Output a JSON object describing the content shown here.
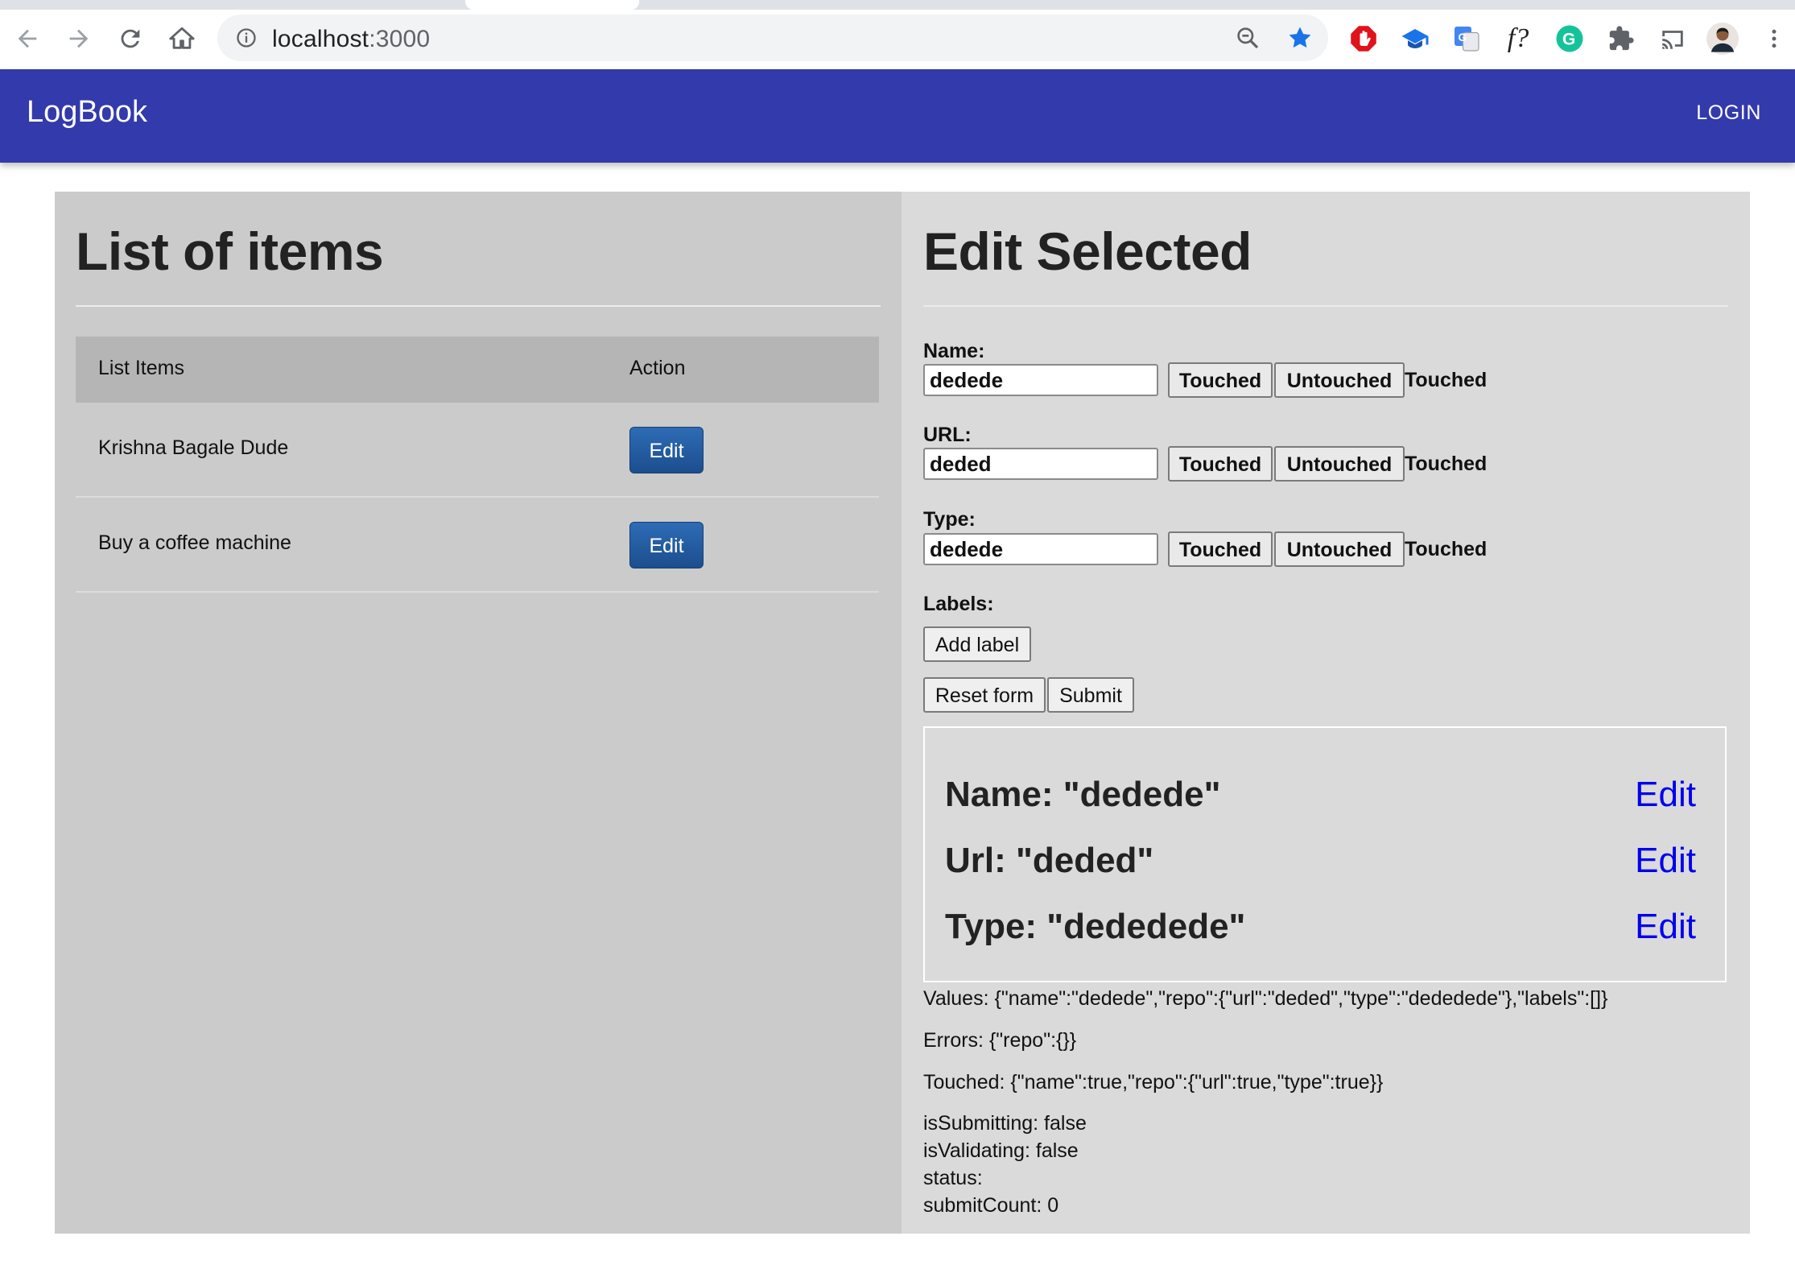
{
  "browser": {
    "url_host": "localhost",
    "url_port": ":3000",
    "colors": {
      "bookmark_star": "#1a73e8"
    },
    "icons": [
      "back-arrow-icon",
      "forward-arrow-icon",
      "reload-icon",
      "home-icon",
      "info-icon",
      "zoom-out-icon",
      "bookmark-star-icon",
      "adblock-icon",
      "graduation-cap-icon",
      "translate-icon",
      "formula-icon",
      "grammarly-icon",
      "extensions-puzzle-icon",
      "cast-icon",
      "profile-avatar",
      "kebab-menu-icon"
    ],
    "formula_text": "f?",
    "grammarly_text": "G",
    "translate_text": "G"
  },
  "appbar": {
    "brand": "LogBook",
    "login_label": "LOGIN",
    "color": "#333aab"
  },
  "list_panel": {
    "title": "List of items",
    "columns": [
      "List Items",
      "Action"
    ],
    "rows": [
      {
        "name": "Krishna Bagale Dude",
        "action": "Edit"
      },
      {
        "name": "Buy a coffee machine",
        "action": "Edit"
      }
    ]
  },
  "edit_panel": {
    "title": "Edit Selected",
    "fields": [
      {
        "label": "Name:",
        "value": "dedede",
        "touched_btn": "Touched",
        "untouched_btn": "Untouched",
        "status": "Touched"
      },
      {
        "label": "URL:",
        "value": "deded",
        "touched_btn": "Touched",
        "untouched_btn": "Untouched",
        "status": "Touched"
      },
      {
        "label": "Type:",
        "value": "dedede",
        "touched_btn": "Touched",
        "untouched_btn": "Untouched",
        "status": "Touched"
      }
    ],
    "labels_label": "Labels:",
    "add_label": "Add label",
    "reset_label": "Reset form",
    "submit_label": "Submit",
    "summary": [
      {
        "text": "Name: \"dedede\"",
        "link": "Edit"
      },
      {
        "text": "Url: \"deded\"",
        "link": "Edit"
      },
      {
        "text": "Type: \"dededede\"",
        "link": "Edit"
      }
    ],
    "debug": {
      "values": "Values: {\"name\":\"dedede\",\"repo\":{\"url\":\"deded\",\"type\":\"dededede\"},\"labels\":[]}",
      "errors": "Errors: {\"repo\":{}}",
      "touched": "Touched: {\"name\":true,\"repo\":{\"url\":true,\"type\":true}}",
      "is_submitting": "isSubmitting: false",
      "is_validating": "isValidating: false",
      "status": "status:",
      "submit_count": "submitCount: 0"
    }
  }
}
